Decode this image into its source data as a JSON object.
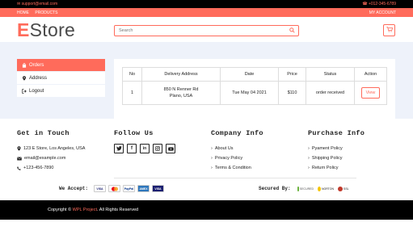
{
  "topbar": {
    "email": "support@email.com",
    "phone": "+012-345-6789"
  },
  "nav": {
    "home": "HOME",
    "products": "PRODUCTS",
    "account": "MY ACCOUNT"
  },
  "logo": {
    "first": "E",
    "rest": "Store"
  },
  "search": {
    "placeholder": "Search",
    "value": ""
  },
  "sidebar": {
    "items": [
      {
        "label": "Orders",
        "icon": "shopping-bag-icon",
        "active": true
      },
      {
        "label": "Address",
        "icon": "map-marker-icon",
        "active": false
      },
      {
        "label": "Logout",
        "icon": "sign-out-icon",
        "active": false
      }
    ]
  },
  "orders": {
    "columns": [
      "No",
      "Delivery Address",
      "Date",
      "Price",
      "Status",
      "Action"
    ],
    "rows": [
      {
        "no": "1",
        "address_line1": "850 N Renner Rd",
        "address_line2": "Plano, USA",
        "date": "Tue May 04 2021",
        "price": "$110",
        "status": "order received",
        "action": "View"
      }
    ]
  },
  "footer": {
    "contact": {
      "title": "Get in Touch",
      "address": "123 E Store, Los Angeles, USA",
      "email": "email@example.com",
      "phone": "+123-456-7890"
    },
    "follow": {
      "title": "Follow Us",
      "icons": [
        "twitter-icon",
        "facebook-icon",
        "linkedin-icon",
        "instagram-icon",
        "youtube-icon"
      ]
    },
    "company": {
      "title": "Company Info",
      "links": [
        "About Us",
        "Privacy Policy",
        "Terms & Condition"
      ]
    },
    "purchase": {
      "title": "Purchase Info",
      "links": [
        "Pyament Policy",
        "Shipping Policy",
        "Return Policy"
      ]
    },
    "accept_label": "We Accept:",
    "cards": [
      "VISA",
      "MC",
      "PayPal",
      "AMEX",
      "VISA"
    ],
    "secured_label": "Secured By:",
    "badges": [
      "SECURED",
      "NORTON",
      "SSL"
    ]
  },
  "copyright": {
    "prefix": "Copyright © ",
    "brand": "WPL Project",
    "suffix": ". All Rights Reserved"
  },
  "colors": {
    "accent": "#ff6b5b",
    "dark": "#000000",
    "bg": "#eef2fa"
  }
}
